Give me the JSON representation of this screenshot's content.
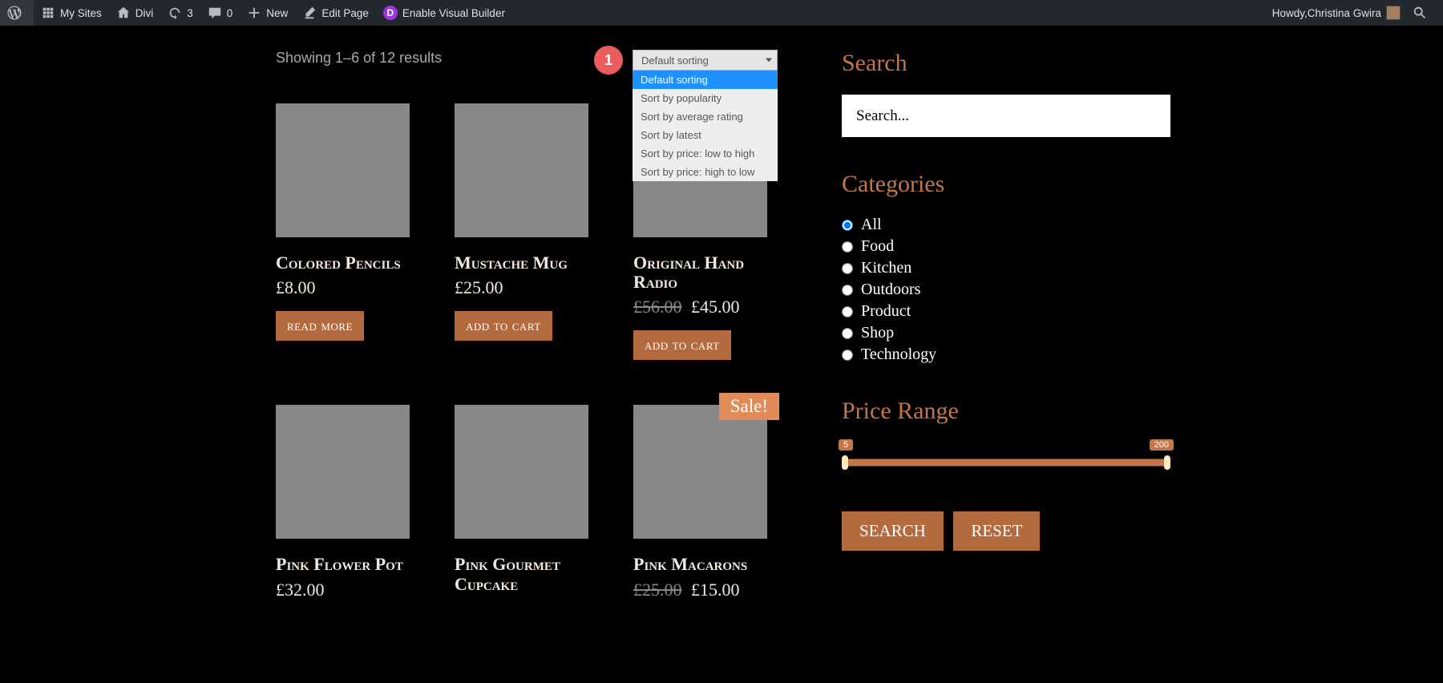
{
  "adminbar": {
    "my_sites": "My Sites",
    "site": "Divi",
    "updates": "3",
    "comments": "0",
    "new": "New",
    "edit_page": "Edit Page",
    "visual_builder": "Enable Visual Builder",
    "howdy_prefix": "Howdy, ",
    "username": "Christina Gwira"
  },
  "shop": {
    "result_count": "Showing 1–6 of 12 results",
    "sort_selected": "Default sorting",
    "sort_options": [
      "Default sorting",
      "Sort by popularity",
      "Sort by average rating",
      "Sort by latest",
      "Sort by price: low to high",
      "Sort by price: high to low"
    ],
    "annotation": "1",
    "products": [
      {
        "title": "Colored Pencils",
        "price": "£8.00",
        "old_price": "",
        "button": "read more",
        "sale": false
      },
      {
        "title": "Mustache Mug",
        "price": "£25.00",
        "old_price": "",
        "button": "add to cart",
        "sale": false
      },
      {
        "title": "Original Hand Radio",
        "price": "£45.00",
        "old_price": "£56.00",
        "button": "add to cart",
        "sale": false
      },
      {
        "title": "Pink Flower Pot",
        "price": "£32.00",
        "old_price": "",
        "button": "",
        "sale": false
      },
      {
        "title": "Pink Gourmet Cupcake",
        "price": "",
        "old_price": "",
        "button": "",
        "sale": false
      },
      {
        "title": "Pink Macarons",
        "price": "£15.00",
        "old_price": "£25.00",
        "button": "",
        "sale": true
      }
    ],
    "sale_label": "Sale!"
  },
  "sidebar": {
    "search_heading": "Search",
    "search_placeholder": "Search...",
    "categories_heading": "Categories",
    "categories": [
      "All",
      "Food",
      "Kitchen",
      "Outdoors",
      "Product",
      "Shop",
      "Technology"
    ],
    "selected_category": "All",
    "price_heading": "Price Range",
    "price_min": "5",
    "price_max": "200",
    "search_btn": "SEARCH",
    "reset_btn": "RESET"
  }
}
